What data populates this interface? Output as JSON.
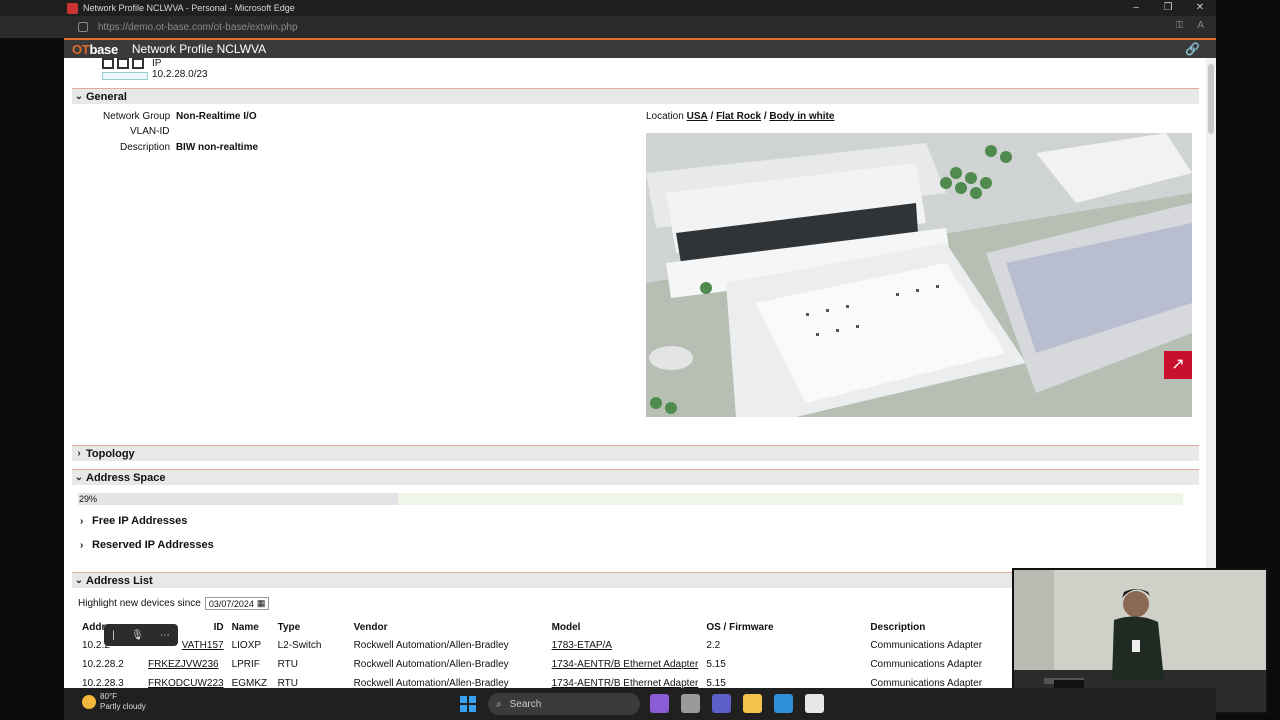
{
  "window": {
    "title": "Network Profile NCLWVA - Personal - Microsoft Edge",
    "url": "https://demo.ot-base.com/ot-base/extwin.php"
  },
  "app": {
    "logo_prefix": "OT",
    "logo_suffix": "base",
    "title": "Network Profile NCLWVA"
  },
  "network": {
    "ip_label": "IP",
    "ip_value": "10.2.28.0/23"
  },
  "general": {
    "heading": "General",
    "group_label": "Network Group",
    "group_value": "Non-Realtime I/O",
    "vlan_label": "VLAN-ID",
    "vlan_value": "",
    "desc_label": "Description",
    "desc_value": "BIW non-realtime",
    "location_label": "Location",
    "location_path": [
      "USA",
      "Flat Rock",
      "Body in white"
    ],
    "separator": "/"
  },
  "topology": {
    "heading": "Topology"
  },
  "address_space": {
    "heading": "Address Space",
    "usage_percent": 29,
    "usage_label": "29%",
    "free_heading": "Free IP Addresses",
    "reserved_heading": "Reserved IP Addresses"
  },
  "address_list": {
    "heading": "Address List",
    "highlight_label": "Highlight new devices since",
    "highlight_date": "03/07/2024",
    "columns": [
      "Addr",
      "ID",
      "Name",
      "Type",
      "Vendor",
      "Model",
      "OS / Firmware",
      "Description"
    ],
    "rows": [
      [
        "10.2.2",
        "VATH157",
        "LIOXP",
        "L2-Switch",
        "Rockwell Automation/Allen-Bradley",
        "1783-ETAP/A",
        "2.2",
        "Communications Adapter"
      ],
      [
        "10.2.28.2",
        "FRKEZJVW236",
        "LPRIF",
        "RTU",
        "Rockwell Automation/Allen-Bradley",
        "1734-AENTR/B Ethernet Adapter",
        "5.15",
        "Communications Adapter"
      ],
      [
        "10.2.28.3",
        "FRKODCUW223",
        "EGMKZ",
        "RTU",
        "Rockwell Automation/Allen-Bradley",
        "1734-AENTR/B Ethernet Adapter",
        "5.15",
        "Communications Adapter"
      ]
    ]
  },
  "taskbar": {
    "temperature": "80°F",
    "weather": "Partly cloudy",
    "search_label": "Search"
  },
  "colors": {
    "accent": "#e36d2f",
    "header_bg": "#3a3a3a",
    "section_bg": "#e8e8e8",
    "badge": "#c8102e"
  }
}
